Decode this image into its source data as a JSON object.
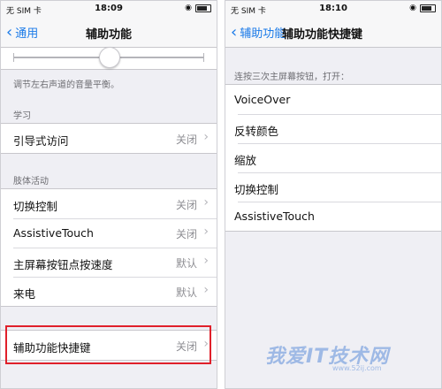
{
  "left": {
    "status": {
      "carrier": "无 SIM 卡",
      "time": "18:09"
    },
    "nav": {
      "back": "通用",
      "title": "辅助功能"
    },
    "balance_footer": "调节左右声道的音量平衡。",
    "balance_level": 0.5,
    "learning": {
      "header": "学习",
      "rows": [
        {
          "label": "引导式访问",
          "value": "关闭"
        }
      ]
    },
    "interaction": {
      "header": "肢体活动",
      "rows": [
        {
          "label": "切换控制",
          "value": "关闭"
        },
        {
          "label": "AssistiveTouch",
          "value": "关闭"
        },
        {
          "label": "主屏幕按钮点按速度",
          "value": "默认"
        },
        {
          "label": "来电",
          "value": "默认"
        }
      ]
    },
    "shortcut": {
      "label": "辅助功能快捷键",
      "value": "关闭"
    }
  },
  "right": {
    "status": {
      "carrier": "无 SIM 卡",
      "time": "18:10"
    },
    "nav": {
      "back": "辅助功能",
      "title": "辅助功能快捷键"
    },
    "header": "连按三次主屏幕按钮，打开：",
    "options": [
      "VoiceOver",
      "反转颜色",
      "缩放",
      "切换控制",
      "AssistiveTouch"
    ]
  },
  "watermark": {
    "text": "我爱IT技术网",
    "url": "www.52ij.com"
  },
  "colors": {
    "accent": "#1a7ae8",
    "highlight": "#e0202a",
    "background": "#efeff4"
  }
}
